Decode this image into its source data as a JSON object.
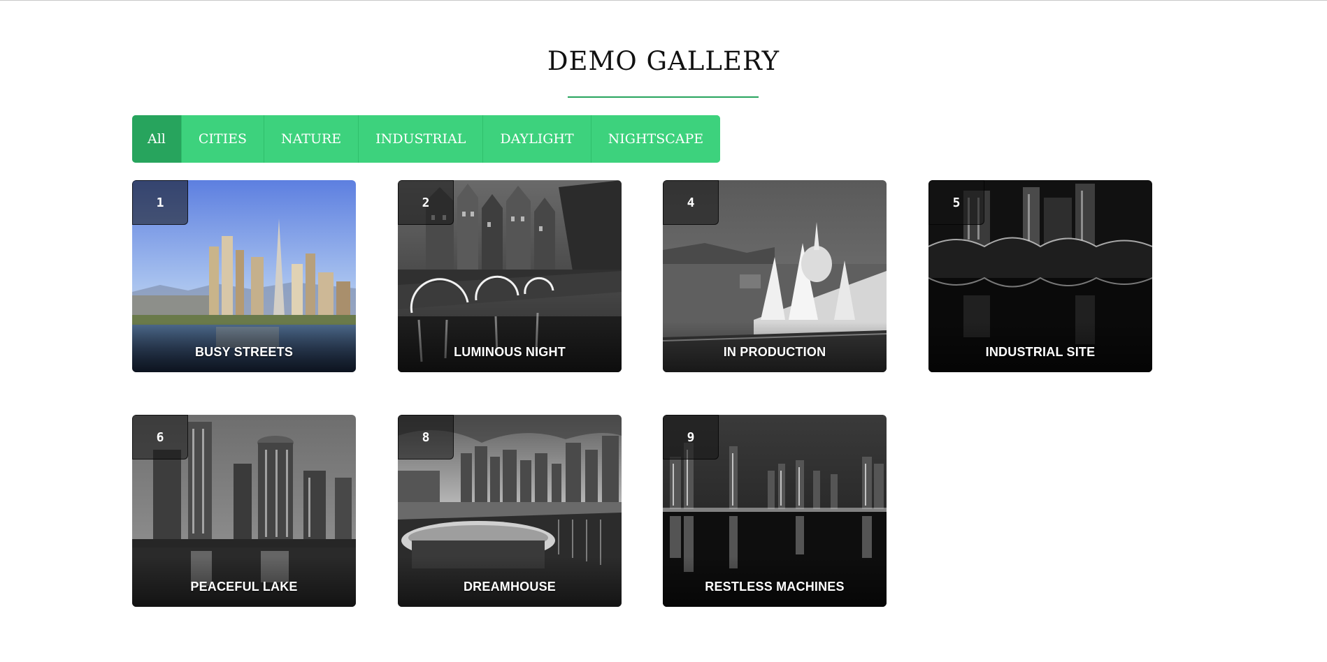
{
  "page": {
    "title": "DEMO GALLERY",
    "accent_color": "#3dd27d",
    "accent_dark": "#27a45d"
  },
  "filters": [
    {
      "label": "All",
      "active": true
    },
    {
      "label": "CITIES",
      "active": false
    },
    {
      "label": "NATURE",
      "active": false
    },
    {
      "label": "INDUSTRIAL",
      "active": false
    },
    {
      "label": "DAYLIGHT",
      "active": false
    },
    {
      "label": "NIGHTSCAPE",
      "active": false
    }
  ],
  "gallery": [
    {
      "number": "1",
      "title": "BUSY STREETS",
      "style": "color"
    },
    {
      "number": "2",
      "title": "LUMINOUS NIGHT",
      "style": "grayscale"
    },
    {
      "number": "4",
      "title": "IN PRODUCTION",
      "style": "grayscale"
    },
    {
      "number": "5",
      "title": "INDUSTRIAL SITE",
      "style": "grayscale"
    },
    {
      "number": "6",
      "title": "PEACEFUL LAKE",
      "style": "grayscale"
    },
    {
      "number": "8",
      "title": "DREAMHOUSE",
      "style": "grayscale"
    },
    {
      "number": "9",
      "title": "RESTLESS MACHINES",
      "style": "grayscale"
    }
  ]
}
